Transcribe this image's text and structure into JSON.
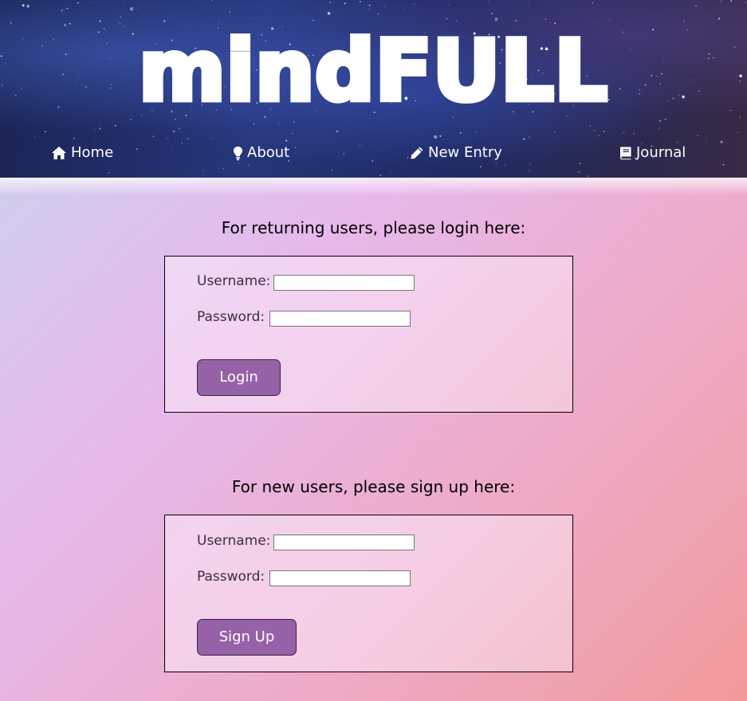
{
  "header": {
    "logo": "mindFULL",
    "nav": [
      {
        "label": "Home",
        "icon": "home-icon"
      },
      {
        "label": "About",
        "icon": "lightbulb-icon"
      },
      {
        "label": "New Entry",
        "icon": "pencil-icon"
      },
      {
        "label": "Journal",
        "icon": "book-icon"
      }
    ]
  },
  "login": {
    "heading": "For returning users, please login here:",
    "username_label": "Username:",
    "username_value": "",
    "password_label": "Password:",
    "password_value": "",
    "button_label": "Login"
  },
  "signup": {
    "heading": "For new users, please sign up here:",
    "username_label": "Username:",
    "username_value": "",
    "password_label": "Password:",
    "password_value": "",
    "button_label": "Sign Up"
  },
  "colors": {
    "button": "#9561a7",
    "header_sky": "#1f2c66"
  }
}
